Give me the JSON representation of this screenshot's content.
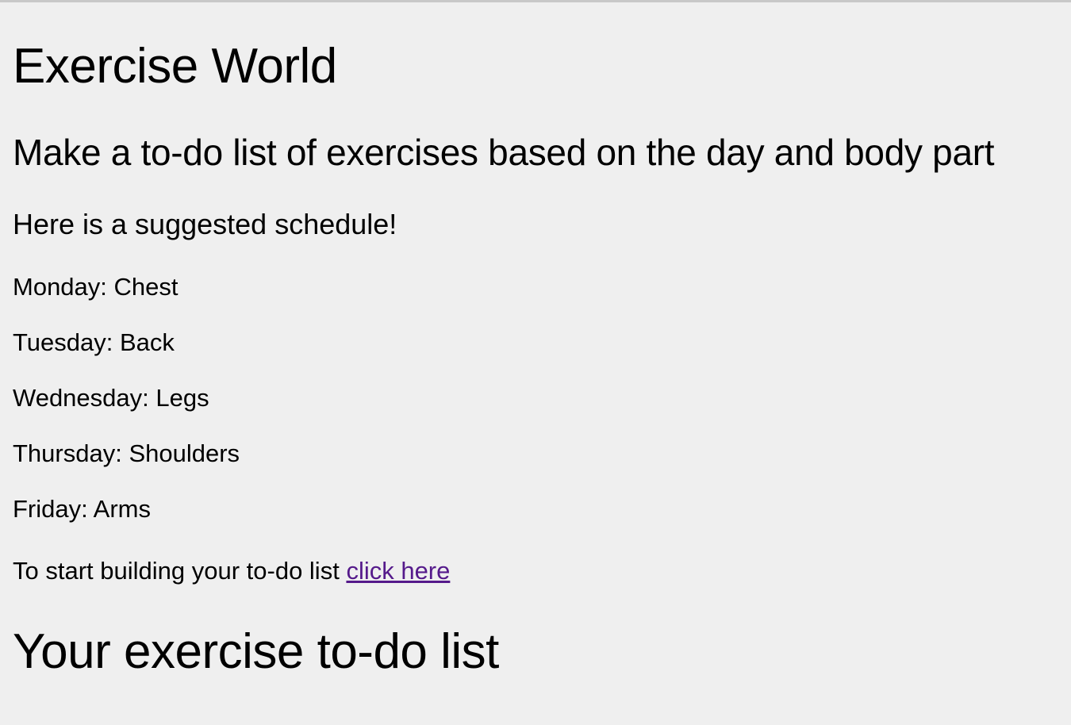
{
  "page": {
    "title": "Exercise World",
    "subtitle": "Make a to-do list of exercises based on the day and body part",
    "schedule_heading": "Here is a suggested schedule!"
  },
  "schedule": [
    {
      "text": "Monday: Chest"
    },
    {
      "text": "Tuesday: Back"
    },
    {
      "text": "Wednesday: Legs"
    },
    {
      "text": "Thursday: Shoulders"
    },
    {
      "text": "Friday: Arms"
    }
  ],
  "cta": {
    "prefix": "To start building your to-do list ",
    "link_label": "click here",
    "link_color": "#551a8b"
  },
  "todo": {
    "heading": "Your exercise to-do list"
  },
  "colors": {
    "background": "#efefef",
    "text": "#000000"
  }
}
